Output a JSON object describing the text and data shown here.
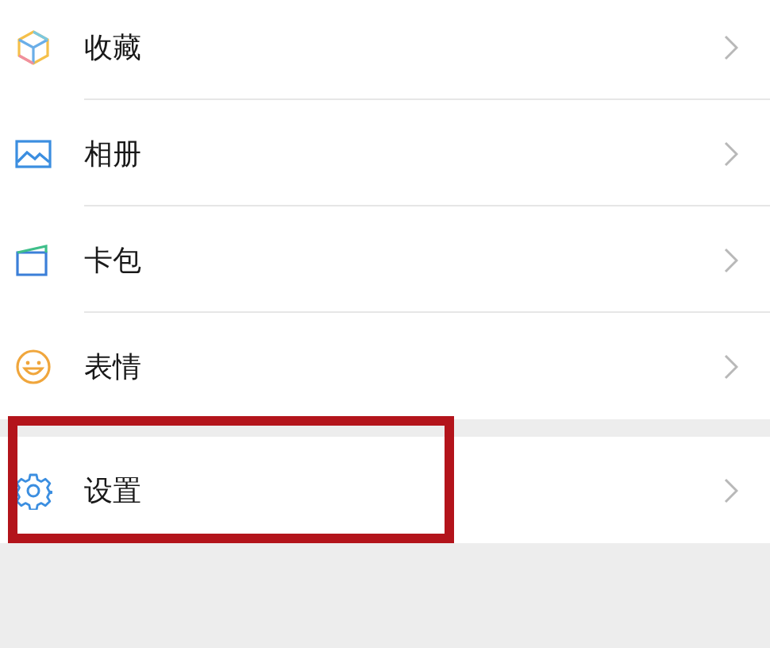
{
  "groups": [
    {
      "items": [
        {
          "label": "收藏",
          "highlighted": false
        },
        {
          "label": "相册",
          "highlighted": false
        },
        {
          "label": "卡包",
          "highlighted": false
        },
        {
          "label": "表情",
          "highlighted": false
        }
      ]
    },
    {
      "items": [
        {
          "label": "设置",
          "highlighted": true
        }
      ]
    }
  ]
}
